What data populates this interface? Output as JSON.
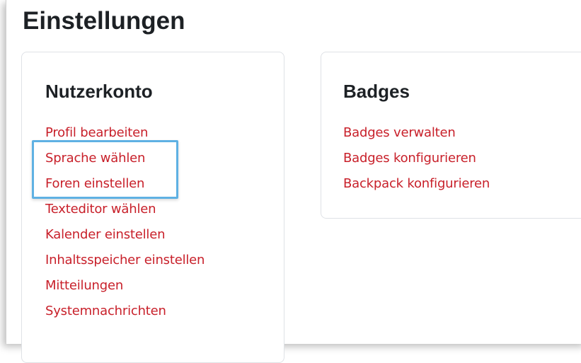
{
  "page": {
    "title": "Einstellungen"
  },
  "account_card": {
    "heading": "Nutzerkonto",
    "links": [
      "Profil bearbeiten",
      "Sprache wählen",
      "Foren einstellen",
      "Texteditor wählen",
      "Kalender einstellen",
      "Inhaltsspeicher einstellen",
      "Mitteilungen",
      "Systemnachrichten"
    ]
  },
  "badges_card": {
    "heading": "Badges",
    "links": [
      "Badges verwalten",
      "Badges konfigurieren",
      "Backpack konfigurieren"
    ]
  },
  "colors": {
    "link": "#c8202a",
    "heading": "#1d2125",
    "highlight": "#5fb1e3"
  }
}
